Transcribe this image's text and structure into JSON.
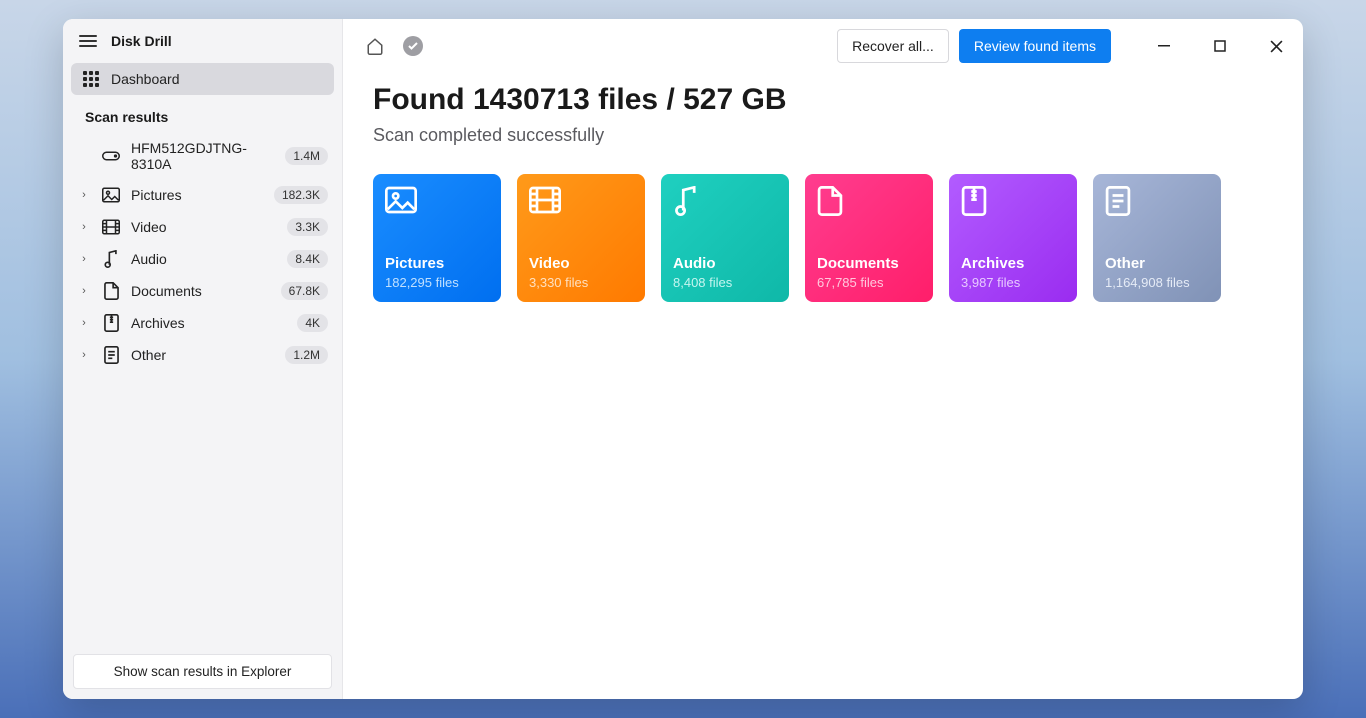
{
  "app": {
    "title": "Disk Drill"
  },
  "sidebar": {
    "dashboard_label": "Dashboard",
    "section_label": "Scan results",
    "drive": {
      "name": "HFM512GDJTNG-8310A",
      "count": "1.4M"
    },
    "items": [
      {
        "label": "Pictures",
        "count": "182.3K"
      },
      {
        "label": "Video",
        "count": "3.3K"
      },
      {
        "label": "Audio",
        "count": "8.4K"
      },
      {
        "label": "Documents",
        "count": "67.8K"
      },
      {
        "label": "Archives",
        "count": "4K"
      },
      {
        "label": "Other",
        "count": "1.2M"
      }
    ],
    "bottom_button": "Show scan results in Explorer"
  },
  "topbar": {
    "recover_label": "Recover all...",
    "review_label": "Review found items"
  },
  "summary": {
    "heading": "Found 1430713 files / 527 GB",
    "subheading": "Scan completed successfully"
  },
  "cards": [
    {
      "title": "Pictures",
      "sub": "182,295 files"
    },
    {
      "title": "Video",
      "sub": "3,330 files"
    },
    {
      "title": "Audio",
      "sub": "8,408 files"
    },
    {
      "title": "Documents",
      "sub": "67,785 files"
    },
    {
      "title": "Archives",
      "sub": "3,987 files"
    },
    {
      "title": "Other",
      "sub": "1,164,908 files"
    }
  ]
}
